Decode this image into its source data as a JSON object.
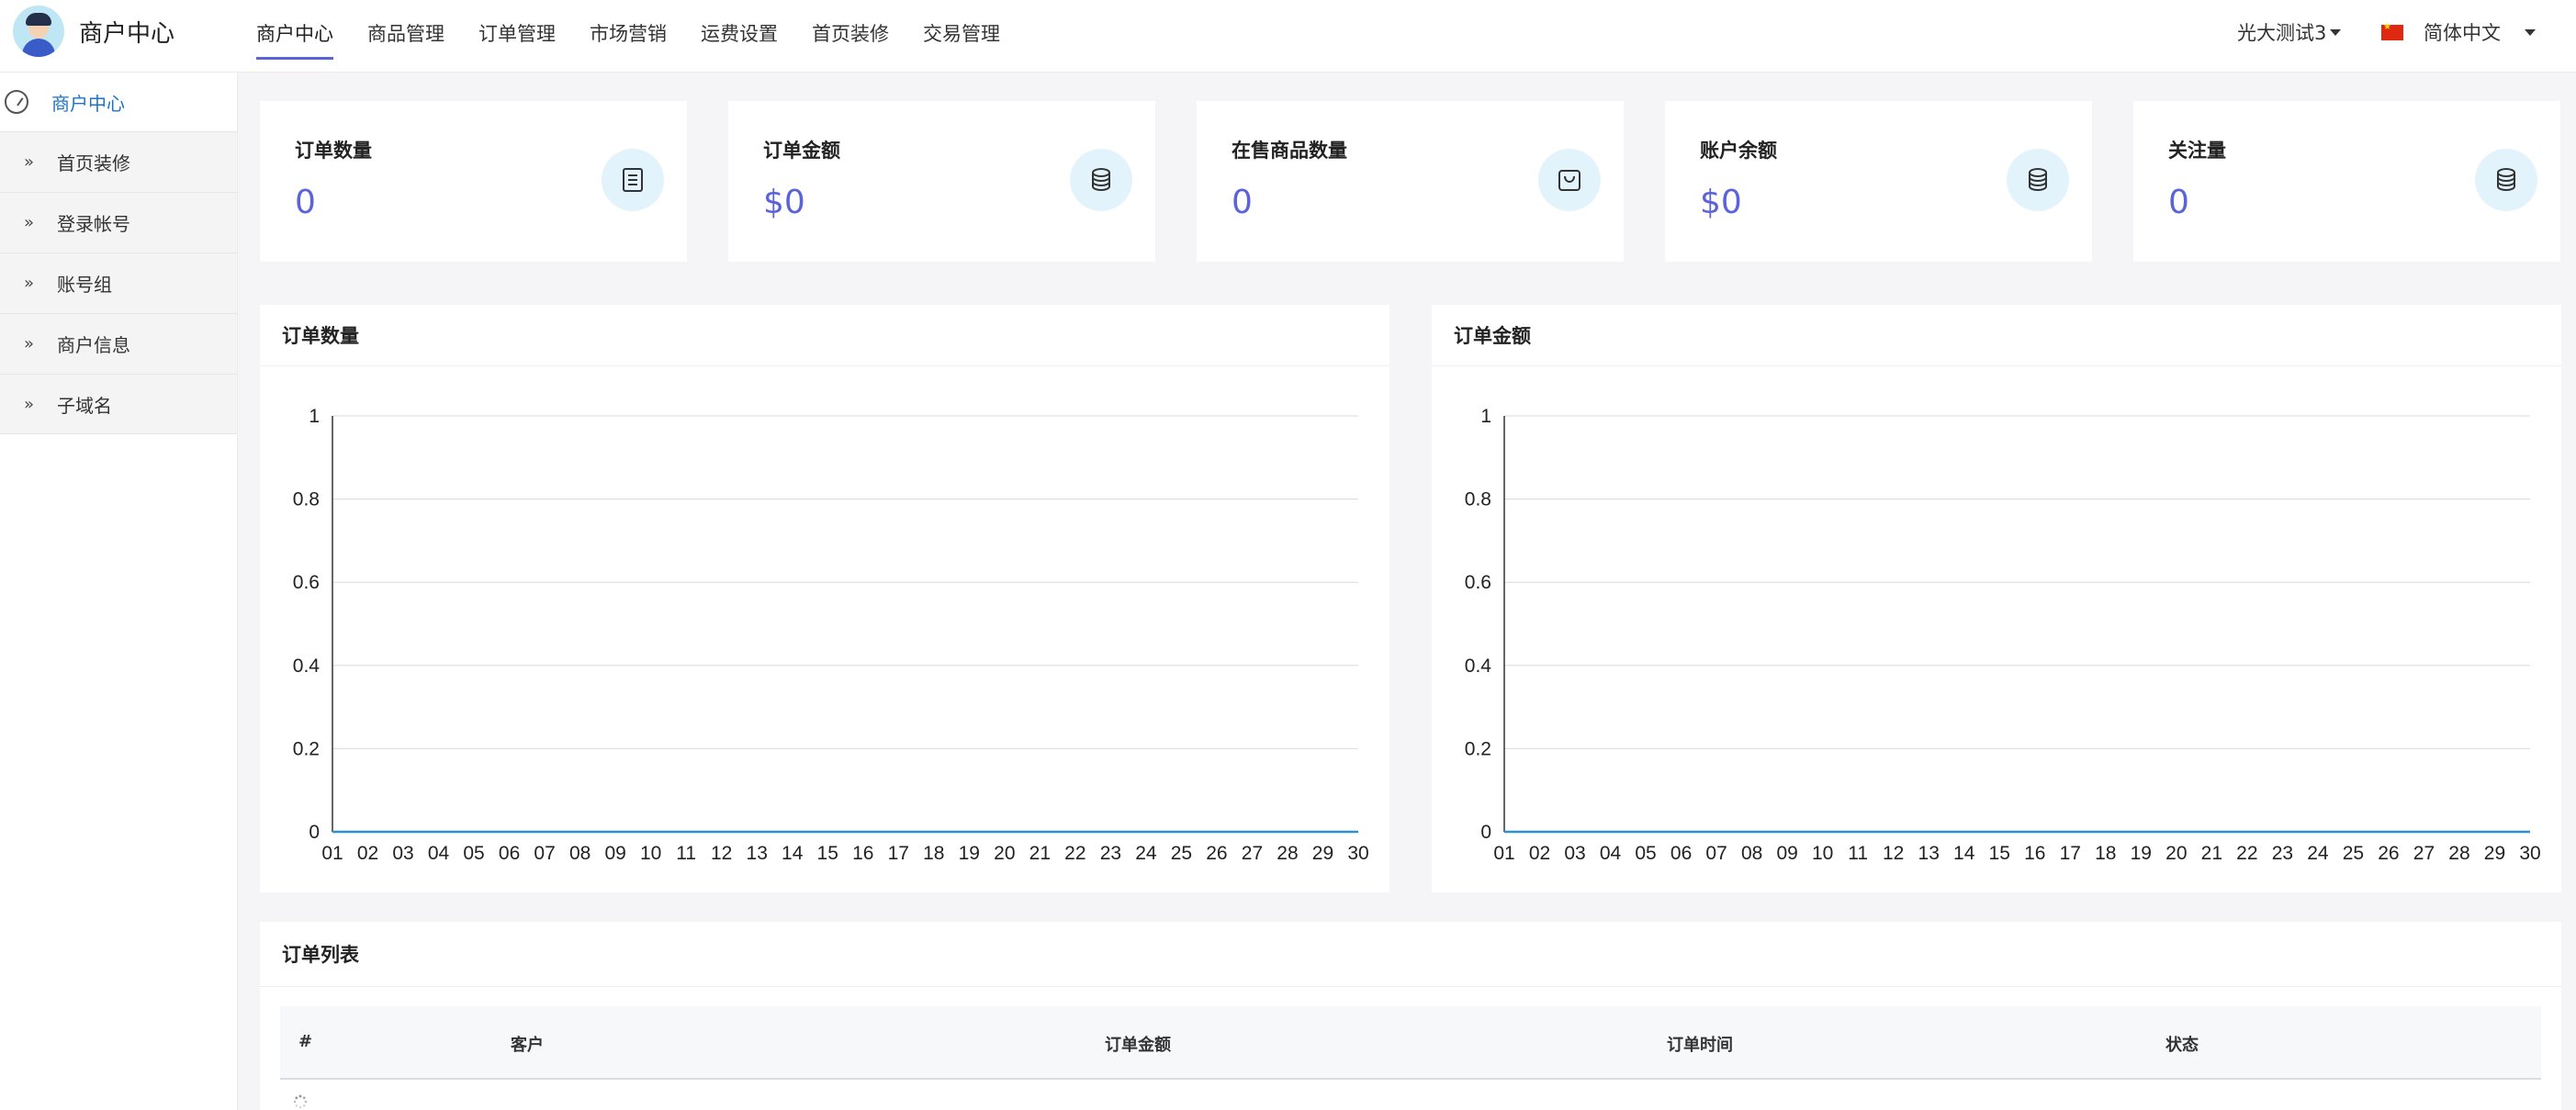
{
  "header": {
    "brand": "商户中心",
    "nav": [
      "商户中心",
      "商品管理",
      "订单管理",
      "市场营销",
      "运费设置",
      "首页装修",
      "交易管理"
    ],
    "active_nav": "商户中心",
    "user": "光大测试3",
    "language": "简体中文"
  },
  "sidebar": {
    "title": "商户中心",
    "items": [
      {
        "label": "首页装修"
      },
      {
        "label": "登录帐号"
      },
      {
        "label": "账号组"
      },
      {
        "label": "商户信息"
      },
      {
        "label": "子域名"
      }
    ]
  },
  "stats": [
    {
      "label": "订单数量",
      "value": "0",
      "icon": "list-icon"
    },
    {
      "label": "订单金额",
      "value": "$0",
      "icon": "coins-icon"
    },
    {
      "label": "在售商品数量",
      "value": "0",
      "icon": "bag-icon"
    },
    {
      "label": "账户余额",
      "value": "$0",
      "icon": "coins-icon"
    },
    {
      "label": "关注量",
      "value": "0",
      "icon": "coins-icon"
    }
  ],
  "colors": {
    "accent": "#5b63d9",
    "sidebar_active": "#1e73c8",
    "line": "#2d8fd6",
    "icon_bg": "#e3f3fb"
  },
  "chart_data": [
    {
      "type": "line",
      "title": "订单数量",
      "categories": [
        "01",
        "02",
        "03",
        "04",
        "05",
        "06",
        "07",
        "08",
        "09",
        "10",
        "11",
        "12",
        "13",
        "14",
        "15",
        "16",
        "17",
        "18",
        "19",
        "20",
        "21",
        "22",
        "23",
        "24",
        "25",
        "26",
        "27",
        "28",
        "29",
        "30"
      ],
      "series": [
        {
          "values": [
            0,
            0,
            0,
            0,
            0,
            0,
            0,
            0,
            0,
            0,
            0,
            0,
            0,
            0,
            0,
            0,
            0,
            0,
            0,
            0,
            0,
            0,
            0,
            0,
            0,
            0,
            0,
            0,
            0,
            0
          ]
        }
      ],
      "yticks": [
        "0",
        "0.2",
        "0.4",
        "0.6",
        "0.8",
        "1"
      ],
      "ylim": [
        0,
        1
      ],
      "grid": true
    },
    {
      "type": "line",
      "title": "订单金额",
      "categories": [
        "01",
        "02",
        "03",
        "04",
        "05",
        "06",
        "07",
        "08",
        "09",
        "10",
        "11",
        "12",
        "13",
        "14",
        "15",
        "16",
        "17",
        "18",
        "19",
        "20",
        "21",
        "22",
        "23",
        "24",
        "25",
        "26",
        "27",
        "28",
        "29",
        "30"
      ],
      "series": [
        {
          "values": [
            0,
            0,
            0,
            0,
            0,
            0,
            0,
            0,
            0,
            0,
            0,
            0,
            0,
            0,
            0,
            0,
            0,
            0,
            0,
            0,
            0,
            0,
            0,
            0,
            0,
            0,
            0,
            0,
            0,
            0
          ]
        }
      ],
      "yticks": [
        "0",
        "0.2",
        "0.4",
        "0.6",
        "0.8",
        "1"
      ],
      "ylim": [
        0,
        1
      ],
      "grid": true
    }
  ],
  "orders": {
    "title": "订单列表",
    "columns": [
      "#",
      "客户",
      "订单金额",
      "订单时间",
      "状态"
    ]
  }
}
